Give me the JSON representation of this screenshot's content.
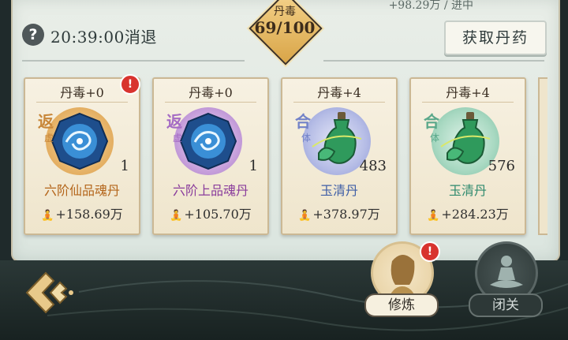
{
  "header": {
    "clipped_text": "+98.29万 / 进中",
    "timer": "20:39:00消退",
    "poison_label": "丹毒",
    "poison_value": "69/100",
    "get_button": "获取丹药"
  },
  "cards": [
    {
      "toxicity": "丹毒+0",
      "stage": "返",
      "stage_sub": "虚",
      "count": "1",
      "name": "六阶仙品魂丹",
      "gain": "+158.69万",
      "alert": "!",
      "name_color": "#b4651a",
      "circle": "radial-gradient(circle at 50% 50%,#f6dcaa,#e7b56b 60%,#d99a45)",
      "stage_color": "#c8873a",
      "icon": "blue-swirl"
    },
    {
      "toxicity": "丹毒+0",
      "stage": "返",
      "stage_sub": "虚",
      "count": "1",
      "name": "六阶上品魂丹",
      "gain": "+105.70万",
      "alert": "",
      "name_color": "#8a3d9c",
      "circle": "radial-gradient(circle at 50% 50%,#ecd7f4,#c9a3dd 60%,#a979c6)",
      "stage_color": "#a56cc4",
      "icon": "blue-swirl"
    },
    {
      "toxicity": "丹毒+4",
      "stage": "合",
      "stage_sub": "体",
      "count": "483",
      "name": "玉清丹",
      "gain": "+378.97万",
      "alert": "",
      "name_color": "#3f5ea6",
      "circle": "radial-gradient(circle at 50% 50%,#e4e6f7,#b6bde6 60%,#8f98d6)",
      "stage_color": "#7282c8",
      "icon": "green-bottle"
    },
    {
      "toxicity": "丹毒+4",
      "stage": "合",
      "stage_sub": "体",
      "count": "576",
      "name": "玉清丹",
      "gain": "+284.23万",
      "alert": "",
      "name_color": "#2f8a6e",
      "circle": "radial-gradient(circle at 50% 50%,#dff2e8,#a9d9c2 60%,#7dbfa3)",
      "stage_color": "#5aa88a",
      "icon": "green-bottle"
    }
  ],
  "actions": {
    "cultivate": {
      "label": "修炼",
      "alert": "!"
    },
    "seclusion": {
      "label": "闭关"
    }
  },
  "colors": {
    "accent": "#d9a548",
    "alert": "#d8332e"
  }
}
